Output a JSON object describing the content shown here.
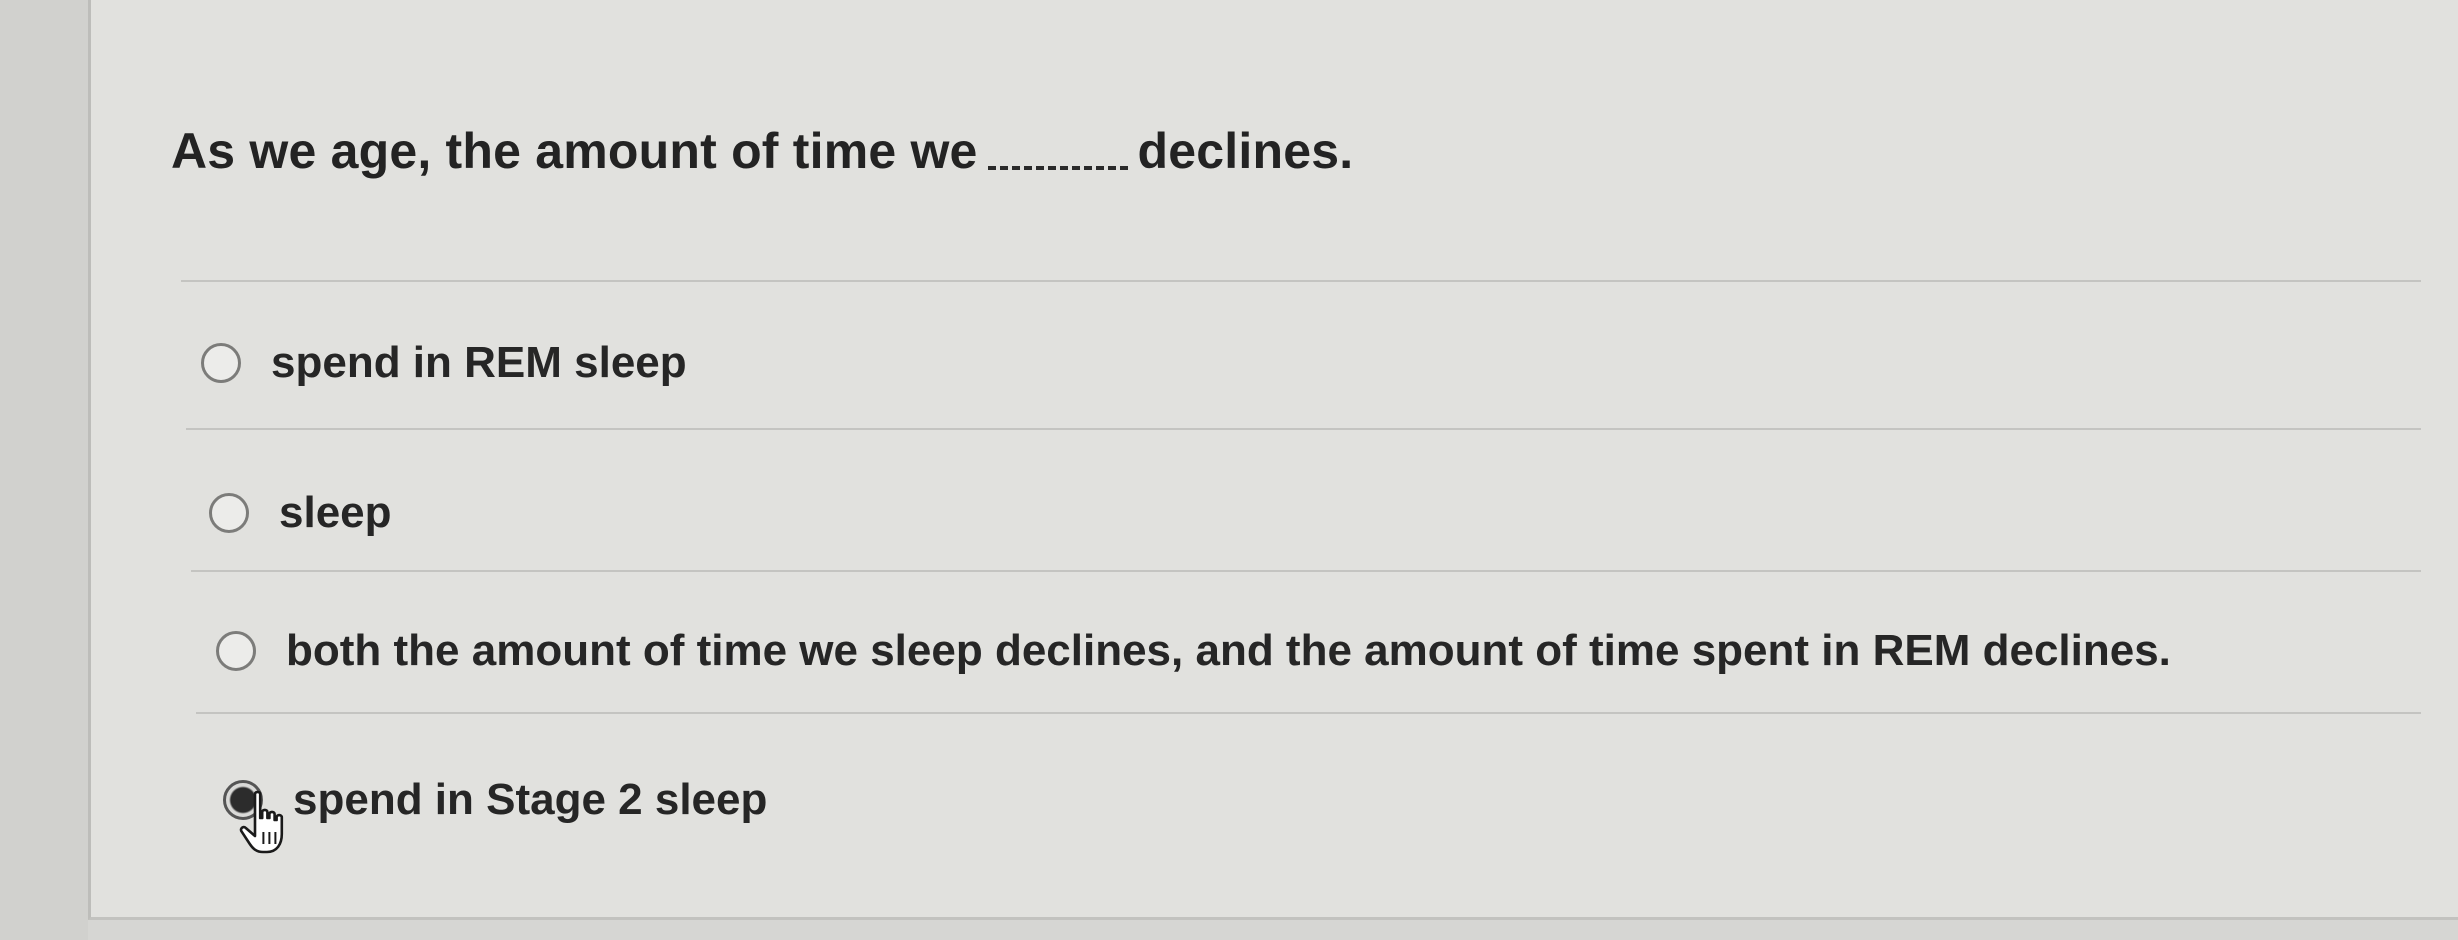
{
  "question": {
    "prefix": "As we age, the amount of time we",
    "suffix": "declines."
  },
  "options": [
    {
      "label": "spend in REM sleep",
      "selected": false
    },
    {
      "label": "sleep",
      "selected": false
    },
    {
      "label": "both the amount of time we sleep declines, and the amount of time spent in REM declines.",
      "selected": false
    },
    {
      "label": "spend in Stage 2 sleep",
      "selected": true
    }
  ],
  "cursor_icon": "hand-pointer-icon"
}
